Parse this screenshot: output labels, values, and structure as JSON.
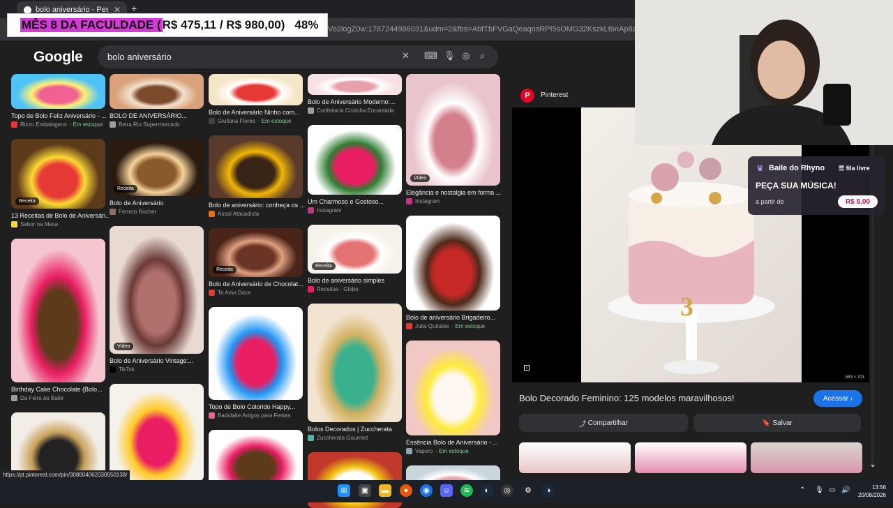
{
  "browser": {
    "tab_title": "bolo aniversário - Pesquisa Google",
    "url": "Vo2logZ0w:1787244986031&udm=2&fbs=AbfTbFVGaQeaqnsRPI5sOMG32KszkLt6nAp8aiRKj5vMjqZAp0c"
  },
  "overlay": {
    "banner_label": "MÊS 8 DA FACULDADE (",
    "banner_amount": "R$ 475,11 / R$ 980,00)",
    "banner_percent": "48%"
  },
  "google": {
    "logo": "Google",
    "query": "bolo aniversário"
  },
  "columns": [
    [
      {
        "caption": "Topo de Bolo Feliz Aniversário - ...",
        "source": "Rizzo Embalagens",
        "stock": "Em estoque",
        "colors": [
          "#4fc3f7",
          "#f06292",
          "#fff176"
        ],
        "src_color": "#e53935"
      },
      {
        "caption": "13 Receitas de Bolo de Aniversári...",
        "source": "Sabor na Mesa",
        "badge": "Receita",
        "colors": [
          "#5d3a1a",
          "#e53935",
          "#fdd835"
        ],
        "src_color": "#fdd835"
      },
      {
        "caption": "Birthday Cake Chocolate (Bolo...",
        "source": "Da Feira ao Baile",
        "colors": [
          "#f4c6cf",
          "#5d3a1a",
          "#e91e63"
        ],
        "src_color": "#9e9e9e"
      },
      {
        "caption": "",
        "source": "",
        "colors": [
          "#f3ede7",
          "#222",
          "#c9a15b"
        ],
        "src_color": "#9e9e9e"
      }
    ],
    [
      {
        "caption": "BOLO DE ANIVERSÁRIO...",
        "source": "Beira Rio Supermercado",
        "colors": [
          "#d9a27a",
          "#7b4a2a",
          "#f4e1cf"
        ],
        "src_color": "#9e9e9e"
      },
      {
        "caption": "Bolo de Aniversário",
        "source": "Ferrero Rocher",
        "badge": "Receita",
        "colors": [
          "#2a1a10",
          "#8b5a2b",
          "#f6d39b"
        ],
        "src_color": "#8d6e63"
      },
      {
        "caption": "Bolo de Aniversário Vintage:...",
        "source": "TikTok",
        "badge": "Vídeo",
        "colors": [
          "#e8d9d3",
          "#b0706b",
          "#6b3a37"
        ],
        "src_color": "#000000"
      },
      {
        "caption": "",
        "source": "",
        "colors": [
          "#f5f2ec",
          "#e91e63",
          "#ffca28"
        ],
        "src_color": "#9e9e9e"
      }
    ],
    [
      {
        "caption": "Bolo de Aniversário Ninho com...",
        "source": "Giuliana Flores",
        "stock": "Em estoque",
        "colors": [
          "#f5e6c8",
          "#e53935",
          "#ffffff"
        ],
        "src_color": "#424242"
      },
      {
        "caption": "Bolo de aniversário: conheça os ...",
        "source": "Assaí Atacadista",
        "colors": [
          "#5a3a2a",
          "#3a2418",
          "#f2b705"
        ],
        "src_color": "#ef6c00"
      },
      {
        "caption": "Bolo de Aniversário de Chocolat...",
        "source": "Te Amo Doce",
        "badge": "Receita",
        "colors": [
          "#4a2418",
          "#6b3526",
          "#e0a082"
        ],
        "src_color": "#e53935"
      },
      {
        "caption": "Topo de Bolo Colorido Happy...",
        "source": "Badulake Artigos para Festas",
        "colors": [
          "#ffffff",
          "#e91e63",
          "#2196f3"
        ],
        "src_color": "#f06292"
      },
      {
        "caption": "",
        "source": "",
        "colors": [
          "#ffffff",
          "#5d3a1a",
          "#e91e63"
        ],
        "src_color": "#9e9e9e"
      }
    ],
    [
      {
        "caption": "Bolo de Aniversário Moderno:...",
        "source": "Confeitaria Cozinha Encantada",
        "colors": [
          "#f8e1e4",
          "#e8a0ab",
          "#ffffff"
        ],
        "src_color": "#9e9e9e"
      },
      {
        "caption": "Um Charmoso e Gostoso...",
        "source": "Instagram",
        "colors": [
          "#ffffff",
          "#e91e63",
          "#2e7d32"
        ],
        "src_color": "#c13584"
      },
      {
        "caption": "Bolo de aniversário simples",
        "source": "Receitas - Globo",
        "badge": "Receita",
        "colors": [
          "#f7f2e9",
          "#e57373",
          "#ffffff"
        ],
        "src_color": "#e91e63"
      },
      {
        "caption": "Bolos Decorados | Zuccherata",
        "source": "Zuccherata Gourmet",
        "colors": [
          "#f3e4d2",
          "#3bb08f",
          "#d4b262"
        ],
        "src_color": "#4db6ac"
      },
      {
        "caption": "",
        "source": "",
        "colors": [
          "#c0392b",
          "#ffffff",
          "#f1c40f"
        ],
        "src_color": "#9e9e9e"
      }
    ],
    [
      {
        "caption": "Elegância e nostalgia em forma ...",
        "source": "Instagram",
        "badge": "Vídeo",
        "colors": [
          "#e9c5cb",
          "#d4808c",
          "#ffffff"
        ],
        "src_color": "#c13584"
      },
      {
        "caption": "Bolo de aniversário Brigadeiro...",
        "source": "Julia Quitutes",
        "stock": "Em estoque",
        "colors": [
          "#ffffff",
          "#c62828",
          "#4e2a1a"
        ],
        "src_color": "#e53935"
      },
      {
        "caption": "Essência Bolo de Aniversário - ...",
        "source": "Vaporo",
        "stock": "Em estoque",
        "colors": [
          "#f2c8c6",
          "#fff8f0",
          "#ffeb3b"
        ],
        "src_color": "#90a4ae"
      },
      {
        "caption": "",
        "source": "",
        "colors": [
          "#c9d6dc",
          "#e8a0ab",
          "#ffffff"
        ],
        "src_color": "#9e9e9e"
      }
    ]
  ],
  "panel": {
    "source_name": "Pinterest",
    "dimensions": "583 × 703",
    "title": "Bolo Decorado Feminino: 125 modelos maravilhosos!",
    "visit_label": "Acessar",
    "share_label": "Compartilhar",
    "save_label": "Salvar"
  },
  "widget": {
    "name": "Baile do Rhyno",
    "queue": "fila livre",
    "headline": "PEÇA SUA MÚSICA!",
    "from_label": "a partir de",
    "price": "R$ 5,00"
  },
  "status_url": "https://pt.pinterest.com/pin/308004062030550138/",
  "taskbar": {
    "time": "13:56",
    "date": "20/08/2026"
  }
}
